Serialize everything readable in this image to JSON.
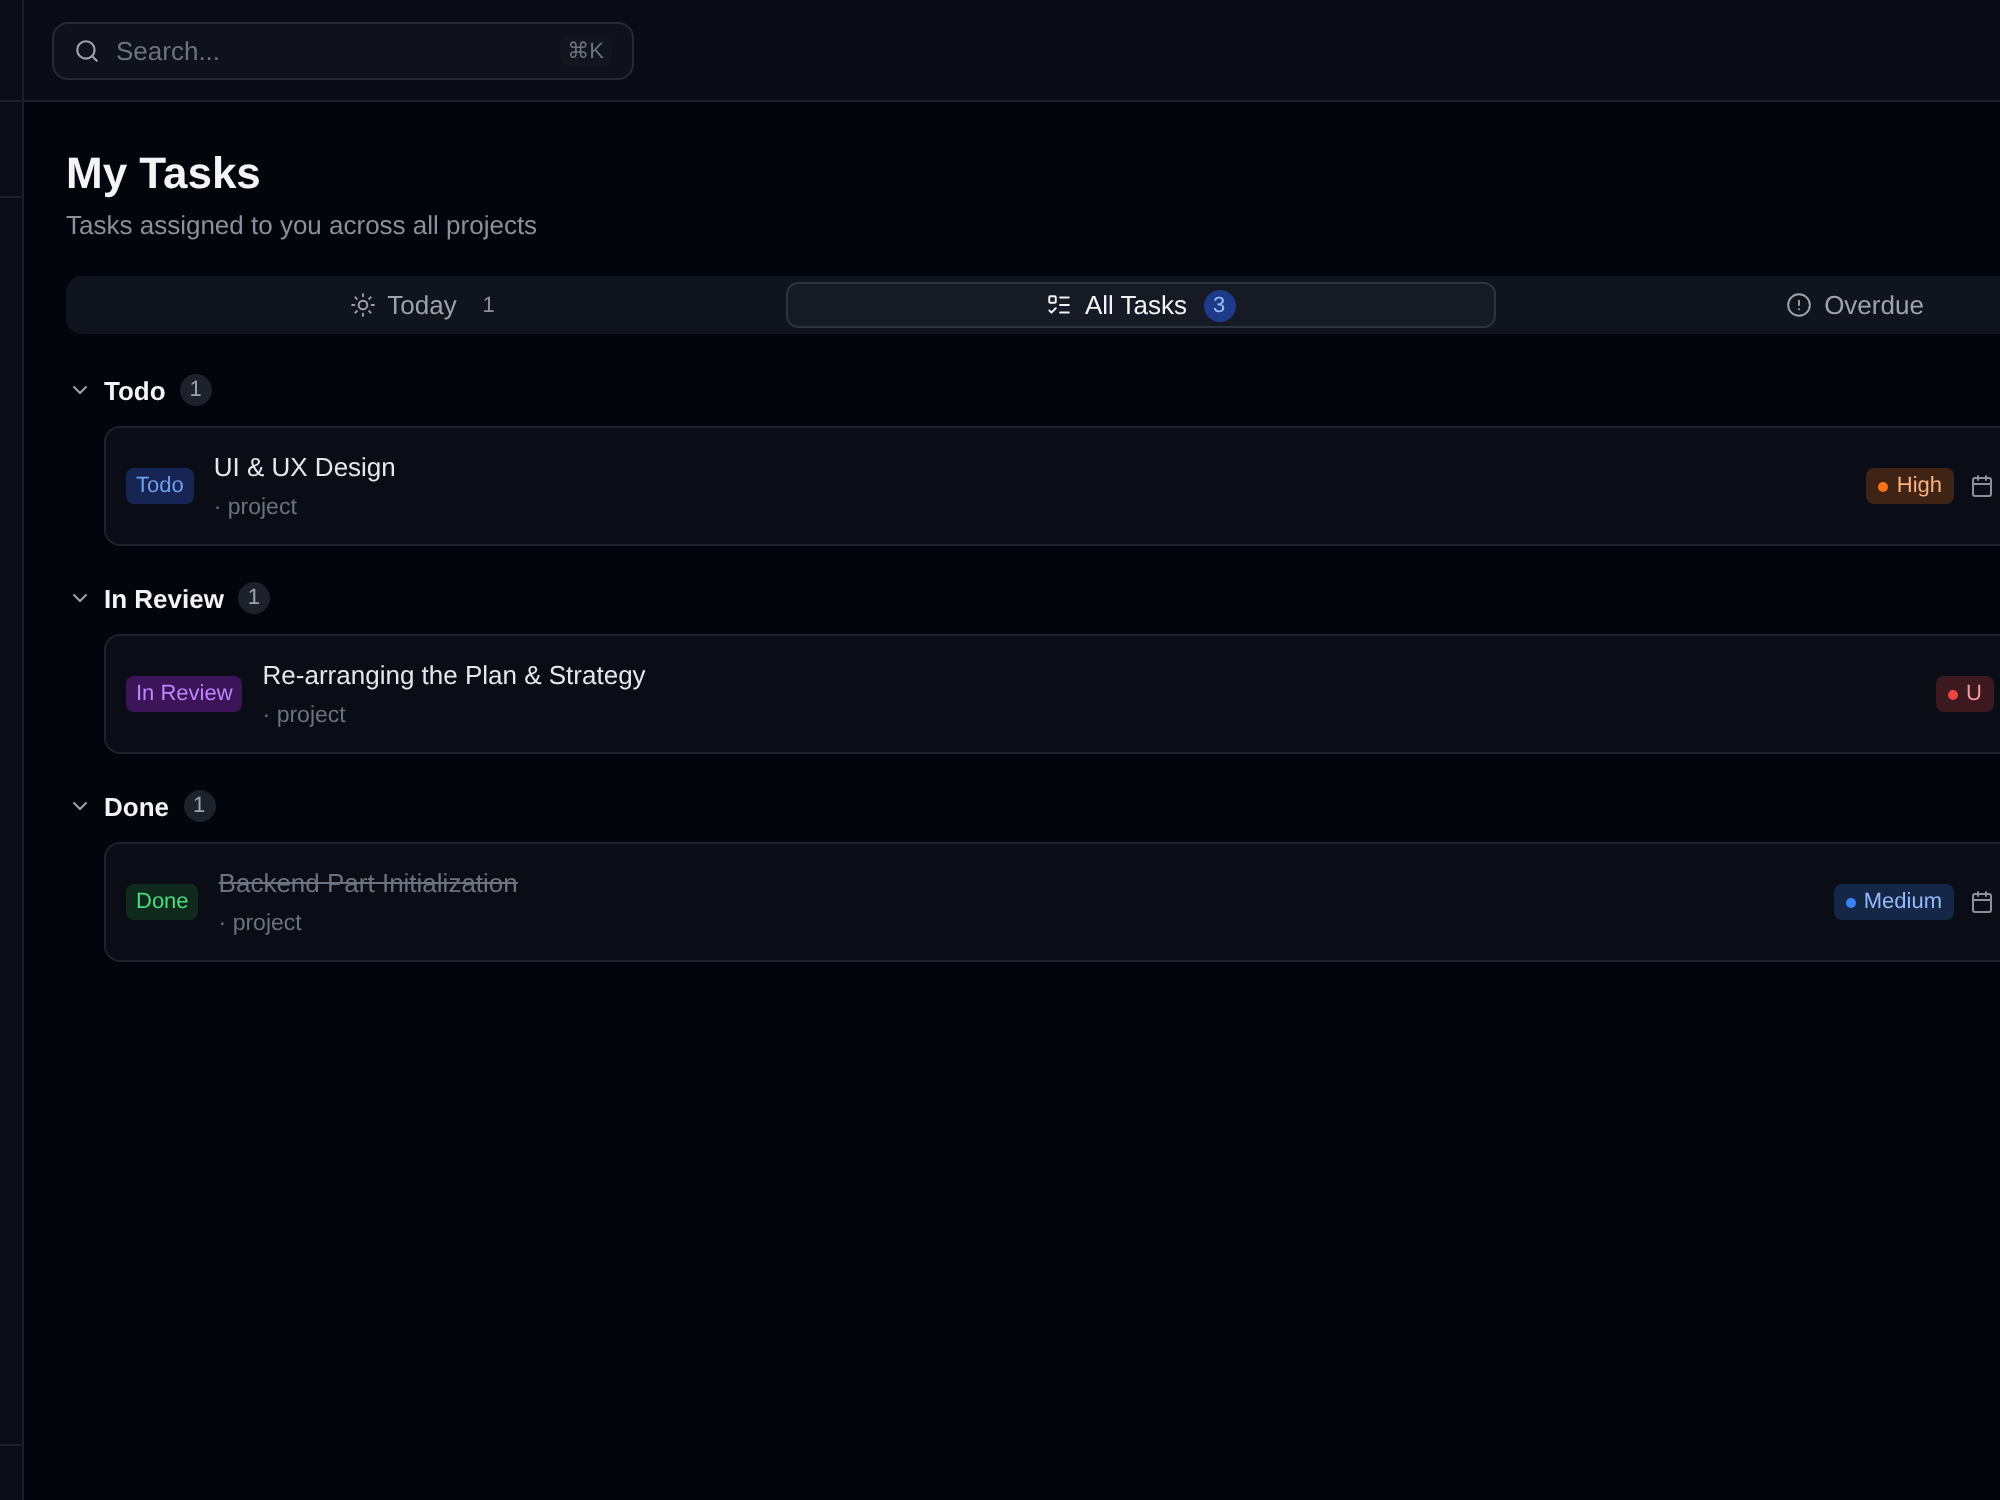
{
  "search": {
    "placeholder": "Search...",
    "shortcut": "⌘K"
  },
  "page": {
    "title": "My Tasks",
    "subtitle": "Tasks assigned to you across all projects"
  },
  "tabs": [
    {
      "label": "Today",
      "count": "1",
      "selected": false
    },
    {
      "label": "All Tasks",
      "count": "3",
      "selected": true
    },
    {
      "label": "Overdue",
      "selected": false
    }
  ],
  "groups": [
    {
      "title": "Todo",
      "count": "1",
      "expanded": true,
      "tasks": [
        {
          "status": {
            "kind": "todo",
            "label": "Todo"
          },
          "title": "UI & UX Design",
          "meta": "· project",
          "completed": false,
          "priority": {
            "label": "High",
            "color": "#f97316"
          },
          "due_icon": true
        }
      ]
    },
    {
      "title": "In Review",
      "count": "1",
      "expanded": true,
      "tasks": [
        {
          "status": {
            "kind": "review",
            "label": "In Review"
          },
          "title": "Re-arranging the Plan & Strategy",
          "meta": "· project",
          "completed": false,
          "priority": {
            "label": "U",
            "color": "#ef4444"
          },
          "due_icon": false
        }
      ]
    },
    {
      "title": "Done",
      "count": "1",
      "expanded": true,
      "tasks": [
        {
          "status": {
            "kind": "done",
            "label": "Done"
          },
          "title": "Backend Part Initialization",
          "meta": "· project",
          "completed": true,
          "priority": {
            "label": "Medium",
            "color": "#3b82f6"
          },
          "due_icon": true
        }
      ]
    }
  ]
}
